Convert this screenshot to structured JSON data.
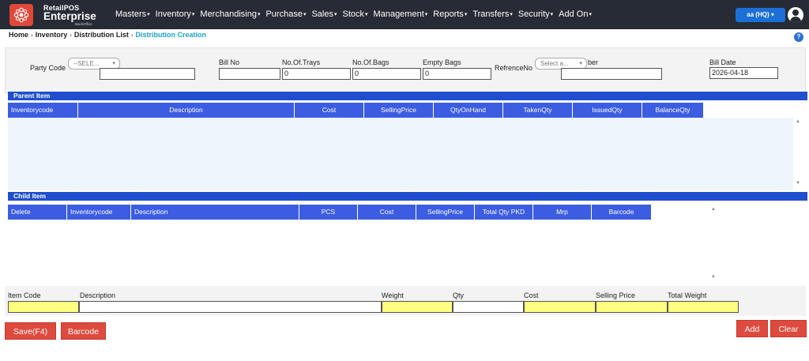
{
  "brand": {
    "top": "RetailPOS",
    "main": "Enterprise",
    "sub": "BackOffice"
  },
  "menu": [
    "Masters",
    "Inventory",
    "Merchandising",
    "Purchase",
    "Sales",
    "Stock",
    "Management",
    "Reports",
    "Transfers",
    "Security",
    "Add On"
  ],
  "store_button": "aa (HQ) ▾",
  "breadcrumb": {
    "home": "Home",
    "inventory": "Inventory",
    "list": "Distribution List",
    "current": "Distribution Creation"
  },
  "help": "?",
  "header_form": {
    "party_code_label": "Party Code",
    "party_code_select": "--SELE...",
    "party_code_value": "",
    "bill_no_label": "Bill No",
    "bill_no_value": "",
    "trays_label": "No.Of.Trays",
    "trays_value": "0",
    "bags_label": "No.Of.Bags",
    "bags_value": "0",
    "empty_bags_label": "Empty Bags",
    "empty_bags_value": "0",
    "reference_label": "RefrenceNo",
    "reference_select": "Select a...",
    "reference_label_tail": "ber",
    "reference_value": "",
    "bill_date_label": "Bill Date",
    "bill_date_value": "2026-04-18"
  },
  "parent_item": {
    "title": "Parent Item",
    "columns": [
      "Inventorycode",
      "Description",
      "Cost",
      "SellingPrice",
      "QtyOnHand",
      "TakenQty",
      "IssuedQty",
      "BalanceQty"
    ]
  },
  "child_item": {
    "title": "Child Item",
    "columns": [
      "Delete",
      "Inventorycode",
      "Description",
      "PCS",
      "Cost",
      "SellingPrice",
      "Total Qty PKD",
      "Mrp",
      "Barcode"
    ]
  },
  "item_entry": {
    "labels": [
      "Item Code",
      "Description",
      "Weight",
      "Qty",
      "Cost",
      "Selling Price",
      "Total Weight"
    ]
  },
  "buttons": {
    "save": "Save(F4)",
    "barcode": "Barcode",
    "add": "Add",
    "clear": "Clear"
  },
  "colors": {
    "navbar": "#262b35",
    "accent_blue": "#1f4fcf",
    "grid_header": "#3c5de2",
    "button_red": "#df4a3e",
    "input_highlight": "#ffff80",
    "breadcrumb_active": "#1aa1c8"
  }
}
